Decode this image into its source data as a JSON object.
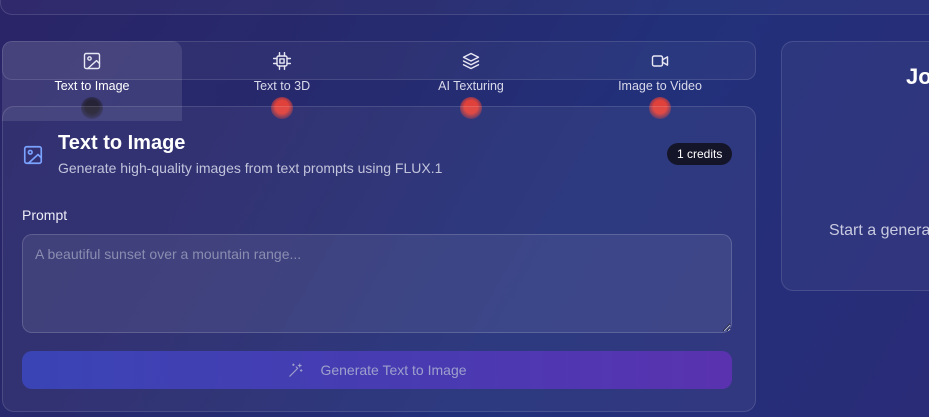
{
  "tabs": [
    {
      "label": "Text to Image",
      "icon": "image-icon",
      "active": true,
      "status": "dark"
    },
    {
      "label": "Text to 3D",
      "icon": "chip-icon",
      "active": false,
      "status": "red"
    },
    {
      "label": "AI Texturing",
      "icon": "layers-icon",
      "active": false,
      "status": "red"
    },
    {
      "label": "Image to Video",
      "icon": "video-icon",
      "active": false,
      "status": "red"
    }
  ],
  "panel": {
    "title": "Text to Image",
    "subtitle": "Generate high-quality images from text prompts using FLUX.1",
    "credits": "1 credits",
    "prompt_label": "Prompt",
    "prompt_placeholder": "A beautiful sunset over a mountain range...",
    "prompt_value": "",
    "generate_label": "Generate Text to Image"
  },
  "side": {
    "title": "Jo",
    "text": "Start a genera"
  },
  "colors": {
    "accent_icon": "#7aa2ff",
    "status_red": "#e0413a",
    "status_dark": "#262336",
    "button_gradient_start": "#3a44b4",
    "button_gradient_end": "#5a32b0"
  }
}
